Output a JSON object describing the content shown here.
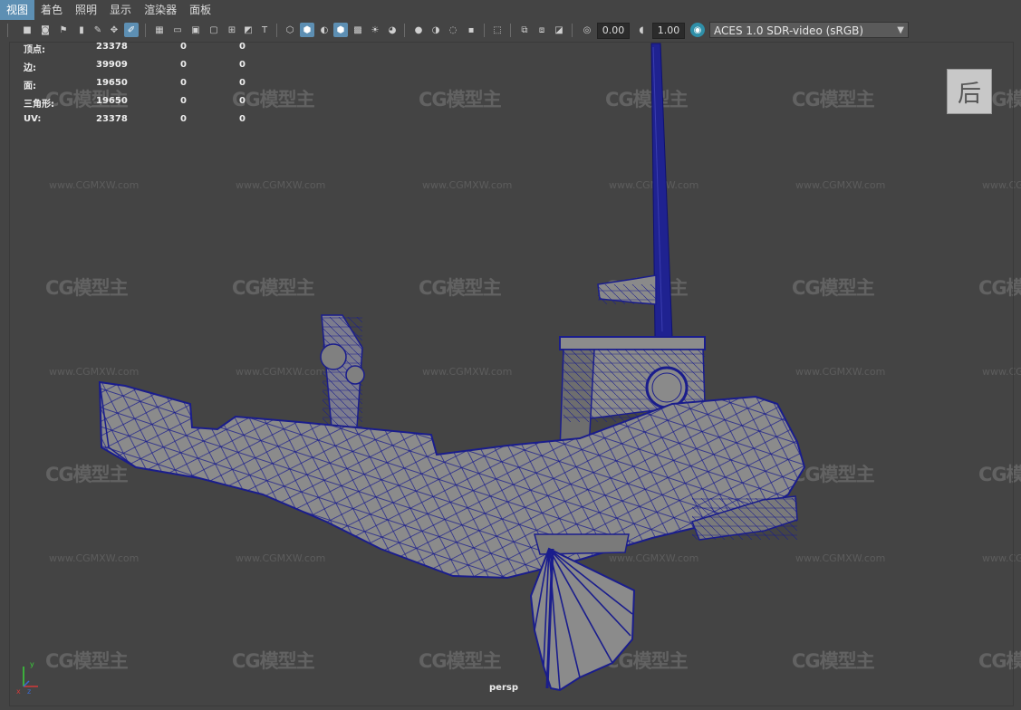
{
  "menubar": {
    "items": [
      "视图",
      "着色",
      "照明",
      "显示",
      "渲染器",
      "面板"
    ]
  },
  "toolbar": {
    "exposure_value": "0.00",
    "gamma_value": "1.00",
    "color_management": "ACES 1.0 SDR-video (sRGB)"
  },
  "hud": {
    "rows": [
      {
        "label": "顶点:",
        "v1": "23378",
        "v2": "0",
        "v3": "0"
      },
      {
        "label": "边:",
        "v1": "39909",
        "v2": "0",
        "v3": "0"
      },
      {
        "label": "面:",
        "v1": "19650",
        "v2": "0",
        "v3": "0"
      },
      {
        "label": "三角形:",
        "v1": "19650",
        "v2": "0",
        "v3": "0"
      },
      {
        "label": "UV:",
        "v1": "23378",
        "v2": "0",
        "v3": "0"
      }
    ]
  },
  "view_cube": {
    "label": "后"
  },
  "camera": {
    "name": "persp"
  },
  "axis": {
    "x": "x",
    "y": "y",
    "z": "z"
  },
  "watermark": {
    "logo": "CG模型主",
    "url": "www.CGMXW.com"
  },
  "colors": {
    "viewport_bg": "#444444",
    "wireframe": "#1a1d8c",
    "mesh_fill": "#8a8a8a",
    "menu_active": "#5d8fb3",
    "axis_x": "#d23a3a",
    "axis_y": "#3ad23a"
  }
}
